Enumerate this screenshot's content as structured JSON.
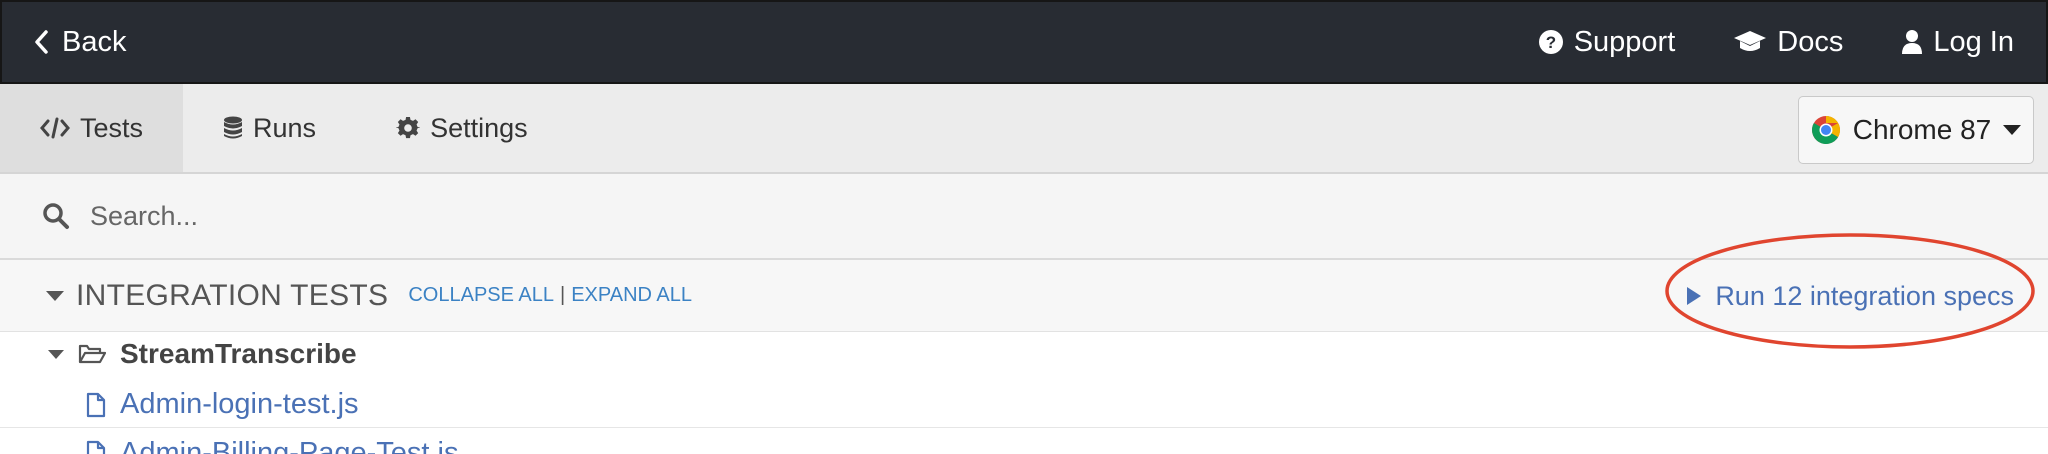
{
  "topbar": {
    "back_label": "Back",
    "support_label": "Support",
    "docs_label": "Docs",
    "login_label": "Log In"
  },
  "tabs": [
    {
      "label": "Tests",
      "active": true
    },
    {
      "label": "Runs",
      "active": false
    },
    {
      "label": "Settings",
      "active": false
    }
  ],
  "browser": {
    "label": "Chrome 87"
  },
  "search": {
    "placeholder": "Search..."
  },
  "integration": {
    "title": "INTEGRATION TESTS",
    "collapse_all": "COLLAPSE ALL",
    "separator": "|",
    "expand_all": "EXPAND ALL",
    "run_label": "Run 12 integration specs"
  },
  "tree": {
    "folder": "StreamTranscribe",
    "files": [
      "Admin-login-test.js",
      "Admin-Billing-Page-Test.js"
    ]
  },
  "colors": {
    "topbar_bg": "#282c33",
    "link_blue": "#4a71b5",
    "annotation_red": "#e0452f"
  }
}
